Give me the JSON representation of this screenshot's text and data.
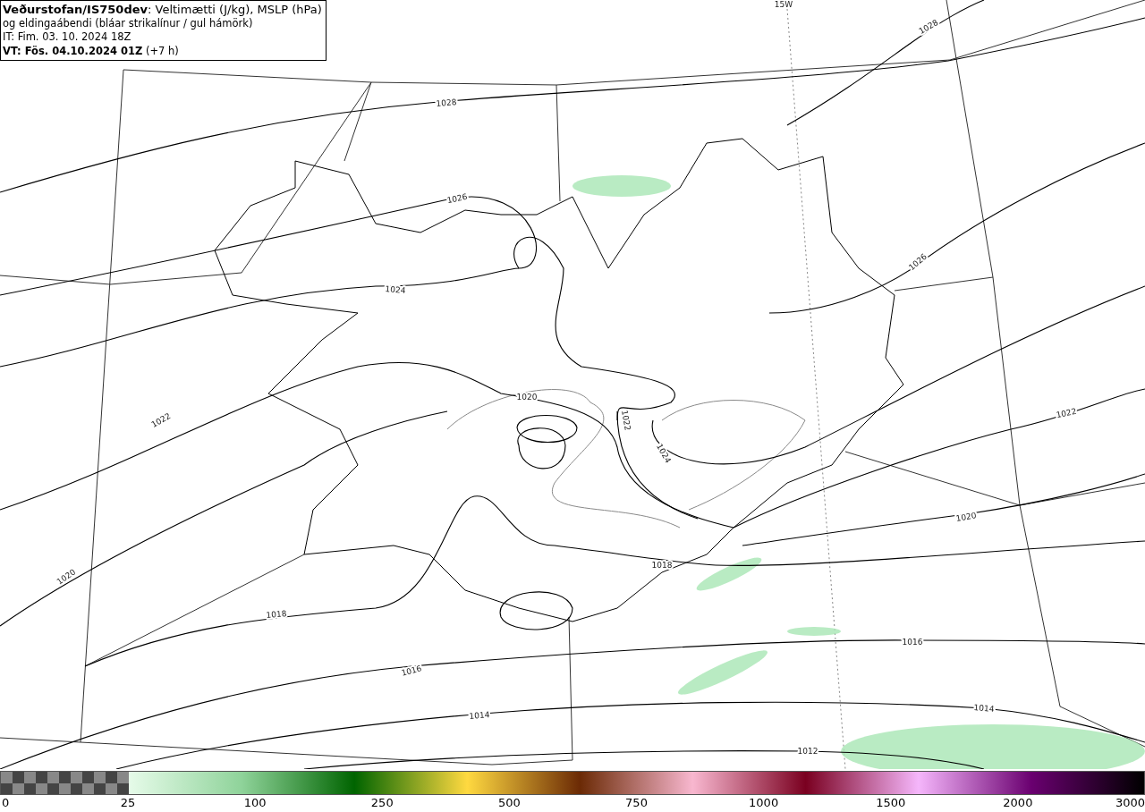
{
  "title_box": {
    "lines": [
      "**Veðurstofan/IS750dev**: Veltimætti (J/kg), MSLP (hPa)",
      "og eldingaábendi (bláar strikalínur / gul hámörk)",
      "IT: Fim. 03. 10. 2024 18Z",
      "**VT: Fös. 04.10.2024 01Z** (+7 h)"
    ]
  },
  "map": {
    "meridian_label": "15W",
    "isobar_labels": [
      {
        "text": "1028"
      },
      {
        "text": "1028"
      },
      {
        "text": "1026"
      },
      {
        "text": "1026"
      },
      {
        "text": "1024"
      },
      {
        "text": "1024"
      },
      {
        "text": "1022"
      },
      {
        "text": "1022"
      },
      {
        "text": "1022"
      },
      {
        "text": "1020"
      },
      {
        "text": "1020"
      },
      {
        "text": "1020"
      },
      {
        "text": "1018"
      },
      {
        "text": "1018"
      },
      {
        "text": "1016"
      },
      {
        "text": "1016"
      },
      {
        "text": "1014"
      },
      {
        "text": "1014"
      },
      {
        "text": "1012"
      }
    ]
  },
  "colorbar": {
    "ticks": [
      "0",
      "25",
      "100",
      "250",
      "500",
      "750",
      "1000",
      "1500",
      "2000",
      "3000"
    ]
  }
}
